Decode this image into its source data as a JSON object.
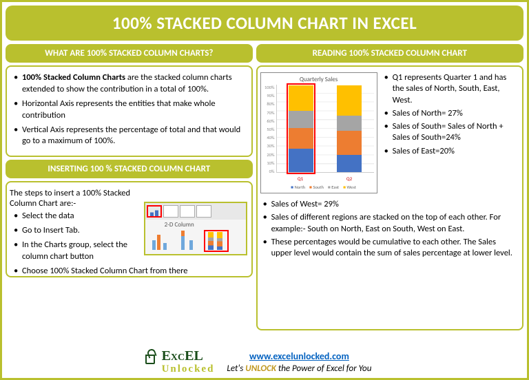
{
  "title": "100% STACKED COLUMN CHART IN EXCEL",
  "left": {
    "header1": "WHAT ARE 100% STACKED COLUMN CHARTS?",
    "bullets1_bold": "100% Stacked Column Charts",
    "bullets1_rest": " are the stacked column charts extended to show the contribution in a total of 100%.",
    "bullet2": "Horizontal Axis represents the entities that make whole contribution",
    "bullet3": "Vertical Axis represents the percentage of total and that would go to a maximum of 100%.",
    "header2": "INSERTING 100 % STACKED COLUMN CHART",
    "steps_intro": "The steps to insert a 100% Stacked Column Chart are:-",
    "step1": "Select the data",
    "step2": "Go to Insert Tab.",
    "step3": "In the Charts group, select the column chart button",
    "step4": "Choose 100% Stacked Column Chart from there",
    "ribbon_label": "2-D Column"
  },
  "right": {
    "header": "READING 100% STACKED COLUMN CHART",
    "r1": "Q1 represents Quarter 1 and has the sales of North, South, East, West.",
    "r2": "Sales of North= 27%",
    "r3": "Sales of South= Sales of North + Sales of South=24%",
    "r4": "Sales of East=20%",
    "b1": "Sales of West= 29%",
    "b2": "Sales of different regions are stacked on the top of each other. For example:-  South on North, East on South, West on East.",
    "b3": "These percentages would be cumulative to each other. The Sales upper level would contain the sum of sales percentage at lower level."
  },
  "chart_data": {
    "type": "bar",
    "title": "Quarterly Sales",
    "categories": [
      "Q1",
      "Q2"
    ],
    "series": [
      {
        "name": "North",
        "values": [
          27,
          20
        ],
        "color": "#4472c4"
      },
      {
        "name": "South",
        "values": [
          24,
          28
        ],
        "color": "#ed7d31"
      },
      {
        "name": "East",
        "values": [
          20,
          17
        ],
        "color": "#a5a5a5"
      },
      {
        "name": "West",
        "values": [
          29,
          35
        ],
        "color": "#ffc000"
      }
    ],
    "ylabel": "%",
    "ylim": [
      0,
      100
    ],
    "y_ticks": [
      "100%",
      "90%",
      "80%",
      "70%",
      "60%",
      "50%",
      "40%",
      "30%",
      "20%",
      "10%",
      "0%"
    ]
  },
  "footer": {
    "logo_top": "EXCEL",
    "logo_bottom": "Unlocked",
    "url": "www.excelunlocked.com",
    "tag_pre": "Let's ",
    "tag_unlock": "UNLOCK",
    "tag_post": " the Power of Excel for You"
  }
}
